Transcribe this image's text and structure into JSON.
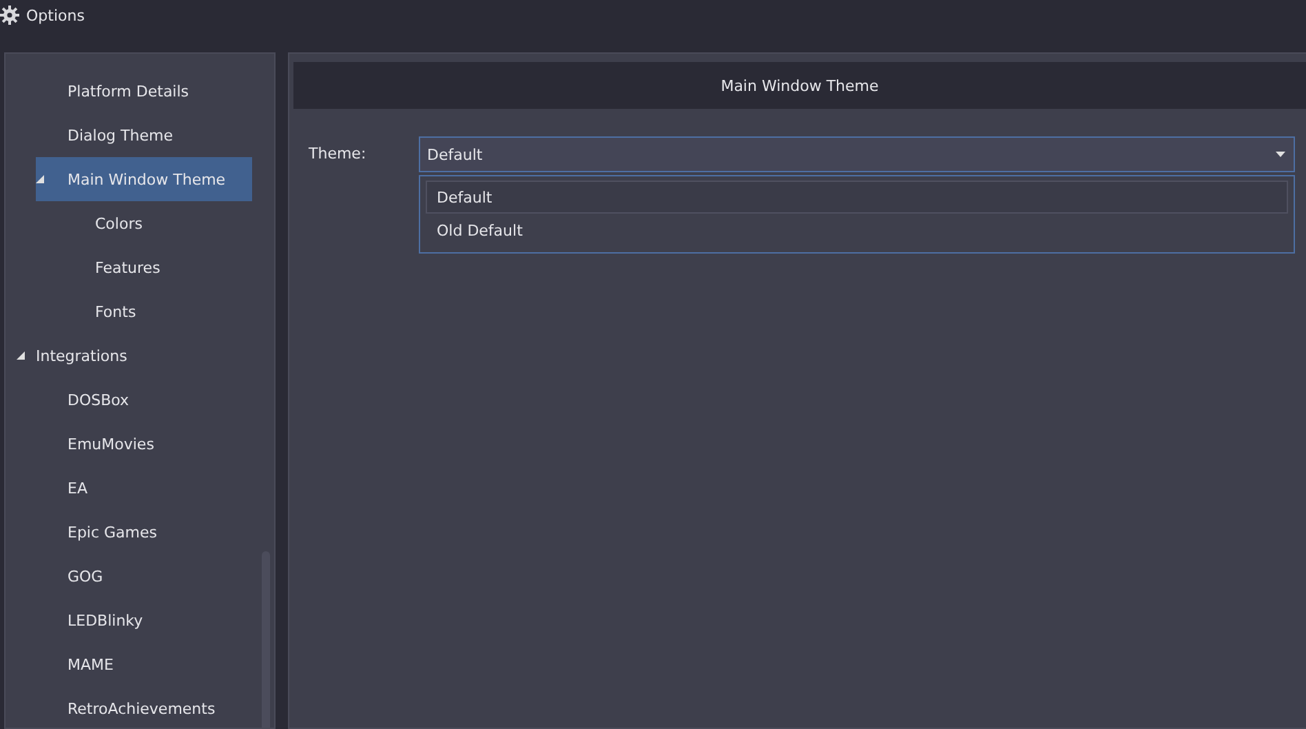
{
  "window": {
    "title": "Options"
  },
  "tree": {
    "items": [
      {
        "children": [
          {
            "label": "Platform Details",
            "selected": false
          },
          {
            "label": "Dialog Theme",
            "selected": false
          },
          {
            "label": "Main Window Theme",
            "selected": true,
            "expanded": true,
            "children": [
              {
                "label": "Colors",
                "selected": false
              },
              {
                "label": "Features",
                "selected": false
              },
              {
                "label": "Fonts",
                "selected": false
              }
            ]
          }
        ]
      },
      {
        "label": "Integrations",
        "selected": false,
        "expanded": true,
        "children": [
          {
            "label": "DOSBox",
            "selected": false
          },
          {
            "label": "EmuMovies",
            "selected": false
          },
          {
            "label": "EA",
            "selected": false
          },
          {
            "label": "Epic Games",
            "selected": false
          },
          {
            "label": "GOG",
            "selected": false
          },
          {
            "label": "LEDBlinky",
            "selected": false
          },
          {
            "label": "MAME",
            "selected": false
          },
          {
            "label": "RetroAchievements",
            "selected": false
          }
        ]
      }
    ]
  },
  "panel": {
    "title": "Main Window Theme",
    "theme_label": "Theme:",
    "theme_value": "Default",
    "dropdown_options": [
      {
        "label": "Default",
        "selected": true
      },
      {
        "label": "Old Default",
        "selected": false
      }
    ]
  }
}
